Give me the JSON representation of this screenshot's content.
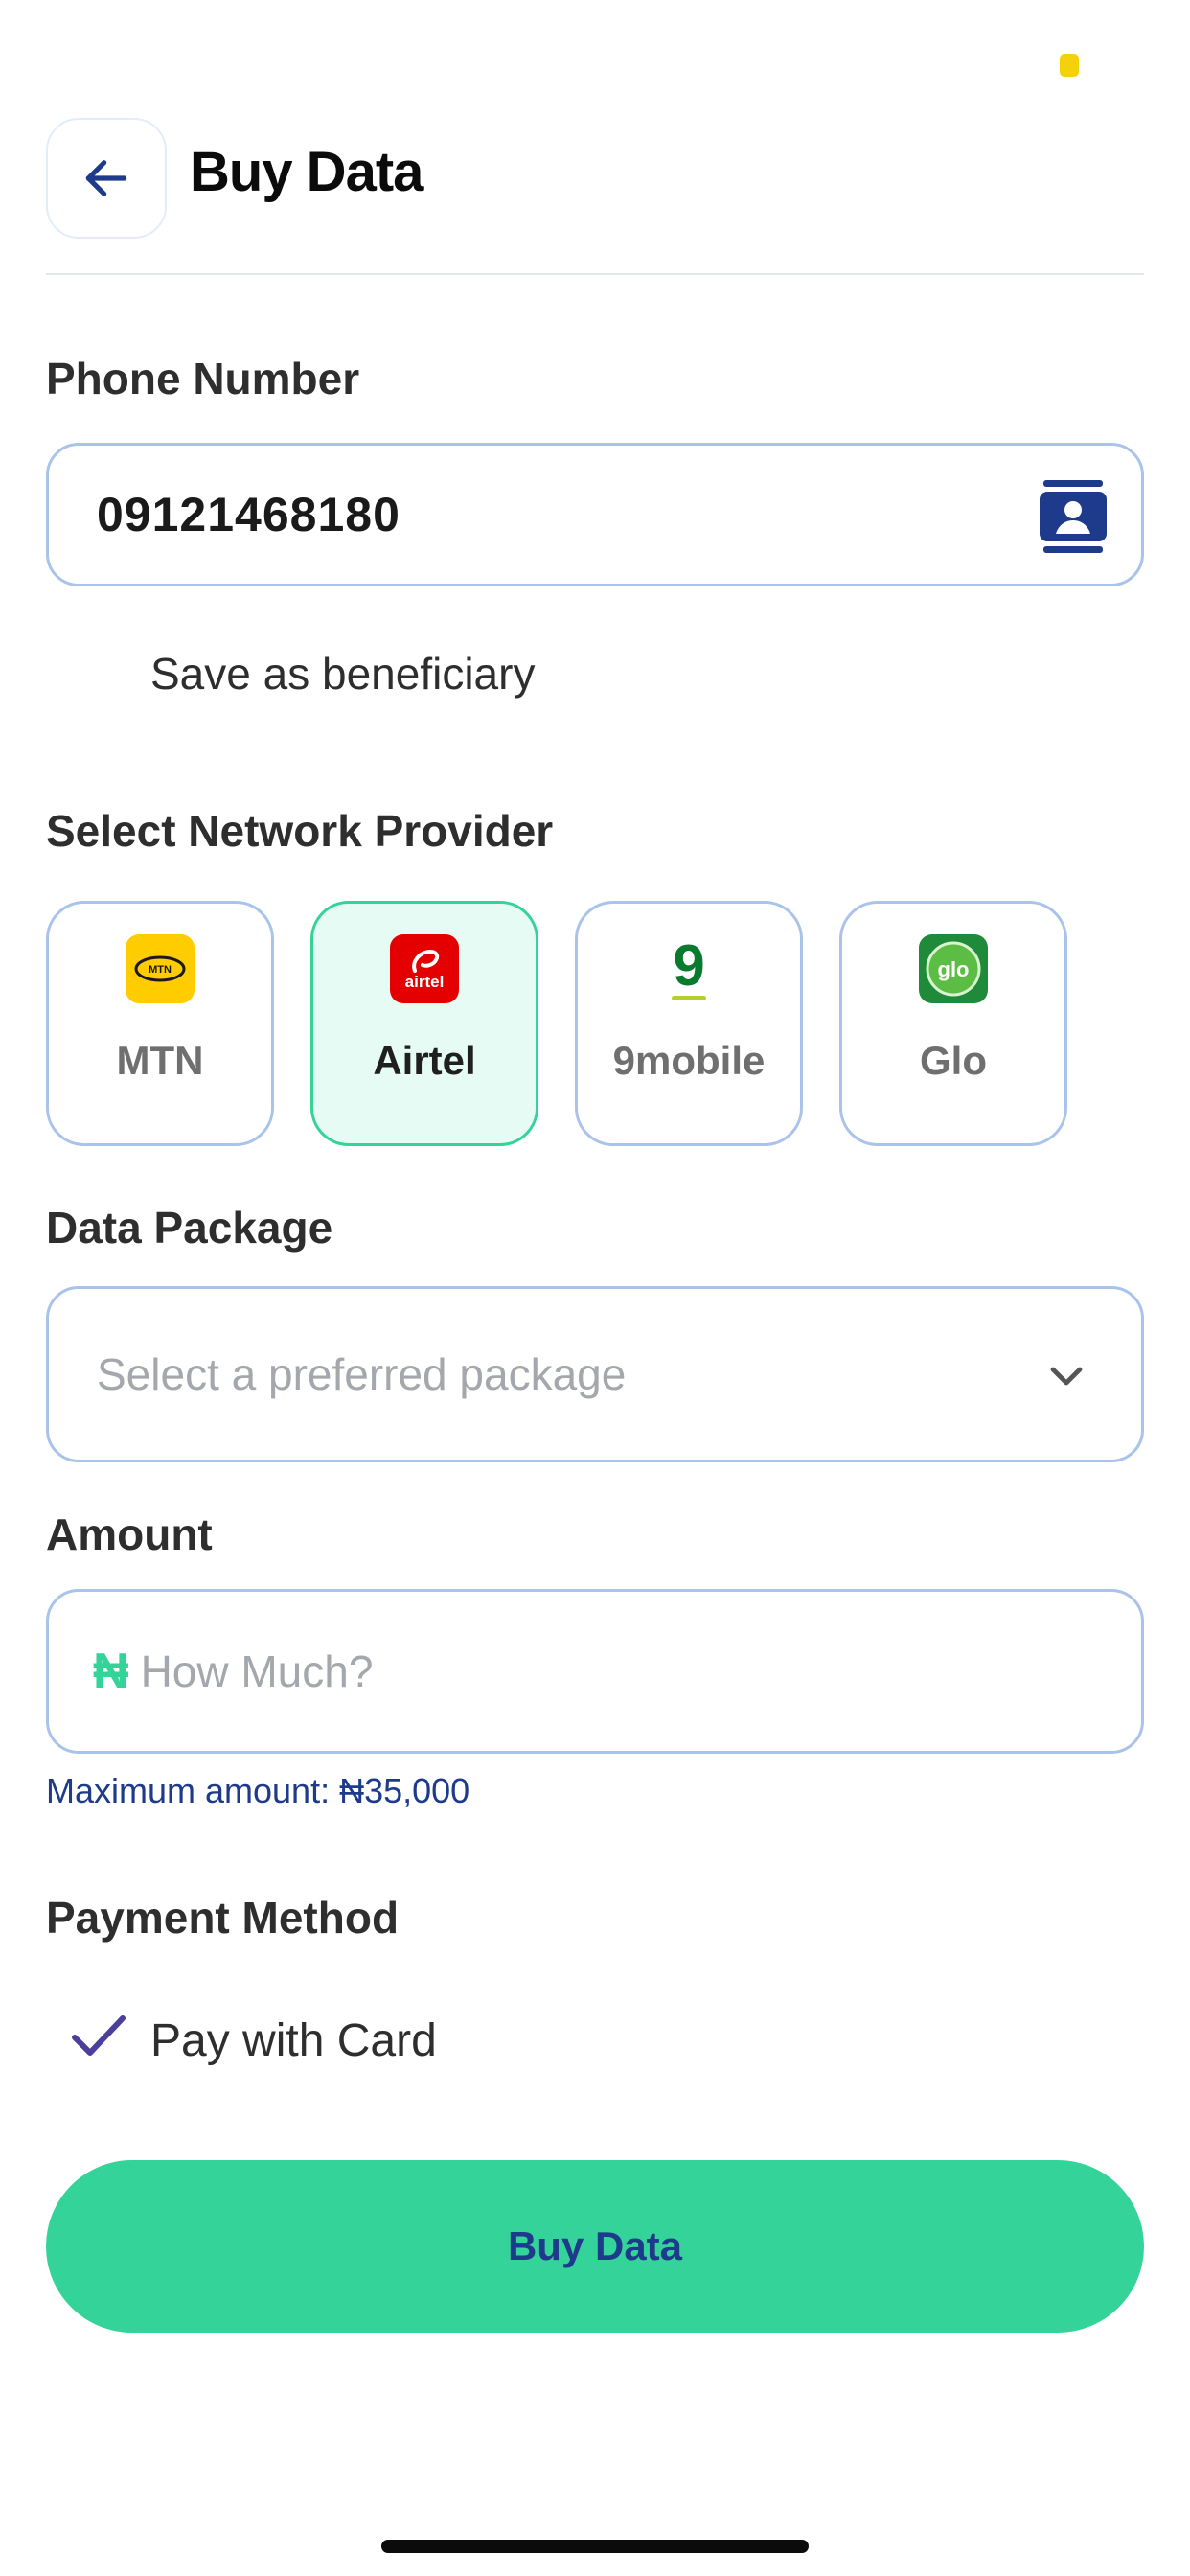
{
  "header": {
    "title": "Buy Data"
  },
  "phone": {
    "label": "Phone Number",
    "value": "09121468180",
    "save_beneficiary_label": "Save as beneficiary"
  },
  "network": {
    "label": "Select Network Provider",
    "providers": [
      {
        "name": "MTN",
        "logo_text": "MTN",
        "selected": false
      },
      {
        "name": "Airtel",
        "logo_text": "airtel",
        "selected": true
      },
      {
        "name": "9mobile",
        "logo_text": "9",
        "selected": false
      },
      {
        "name": "Glo",
        "logo_text": "glo",
        "selected": false
      }
    ]
  },
  "package": {
    "label": "Data Package",
    "placeholder": "Select a preferred package"
  },
  "amount": {
    "label": "Amount",
    "currency_symbol": "₦",
    "placeholder": "How Much?",
    "max_note": "Maximum amount: ₦35,000"
  },
  "payment": {
    "label": "Payment Method",
    "option": "Pay with Card"
  },
  "submit": {
    "label": "Buy Data"
  },
  "colors": {
    "accent_green": "#34d399",
    "navy": "#1e3a8a",
    "field_border": "#a9c3ea",
    "status_yellow": "#f5d10b"
  }
}
